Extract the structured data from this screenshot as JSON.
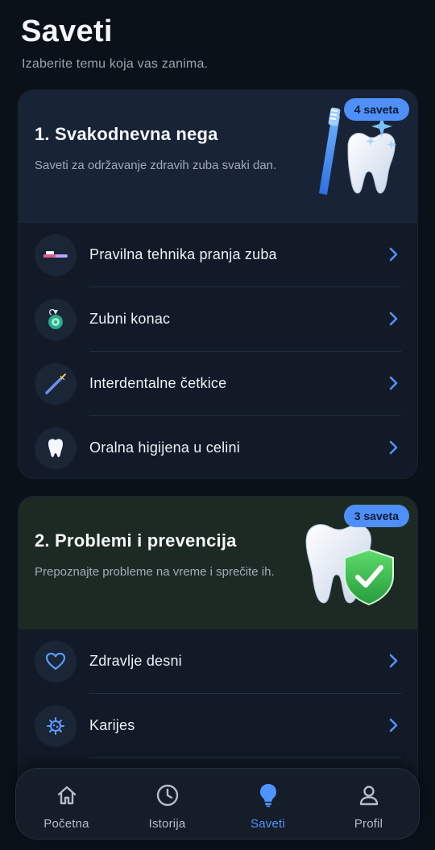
{
  "header": {
    "title": "Saveti",
    "subtitle": "Izaberite temu koja vas zanima."
  },
  "categories": [
    {
      "title": "1. Svakodnevna nega",
      "description": "Saveti za održavanje zdravih zuba svaki dan.",
      "badge": "4 saveta",
      "items": [
        {
          "label": "Pravilna tehnika pranja zuba",
          "icon": "toothbrush-icon"
        },
        {
          "label": "Zubni konac",
          "icon": "floss-icon"
        },
        {
          "label": "Interdentalne četkice",
          "icon": "interdental-brush-icon"
        },
        {
          "label": "Oralna higijena u celini",
          "icon": "tooth-icon"
        }
      ]
    },
    {
      "title": "2. Problemi i prevencija",
      "description": "Prepoznajte probleme na vreme i sprečite ih.",
      "badge": "3 saveta",
      "items": [
        {
          "label": "Zdravlje desni",
          "icon": "heart-icon"
        },
        {
          "label": "Karijes",
          "icon": "bacteria-icon"
        }
      ]
    }
  ],
  "tabbar": {
    "tabs": [
      {
        "label": "Početna",
        "icon": "home-icon",
        "active": false
      },
      {
        "label": "Istorija",
        "icon": "clock-icon",
        "active": false
      },
      {
        "label": "Saveti",
        "icon": "lightbulb-icon",
        "active": true
      },
      {
        "label": "Profil",
        "icon": "profile-icon",
        "active": false
      }
    ]
  },
  "colors": {
    "background": "#0b1119",
    "card": "#111a26",
    "accent": "#4f8ff7",
    "text_secondary": "#9aa3b2"
  }
}
